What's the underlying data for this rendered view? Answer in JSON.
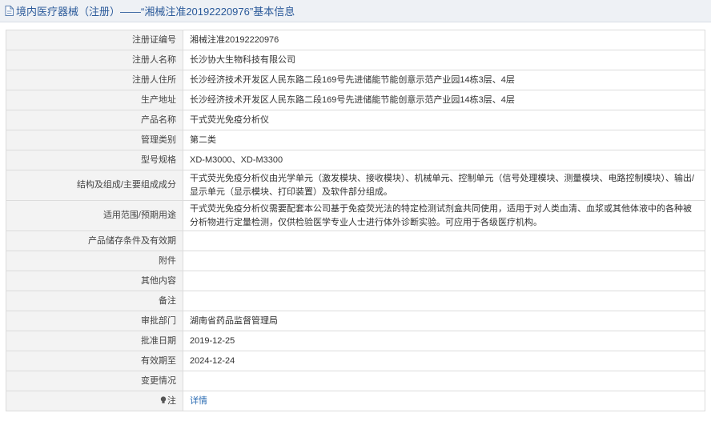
{
  "header": {
    "title": "境内医疗器械（注册）——“湘械注准20192220976”基本信息",
    "icon": "document-icon"
  },
  "rows": [
    {
      "label": "注册证编号",
      "value": "湘械注准20192220976"
    },
    {
      "label": "注册人名称",
      "value": "长沙协大生物科技有限公司"
    },
    {
      "label": "注册人住所",
      "value": "长沙经济技术开发区人民东路二段169号先进储能节能创意示范产业园14栋3层、4层"
    },
    {
      "label": "生产地址",
      "value": "长沙经济技术开发区人民东路二段169号先进储能节能创意示范产业园14栋3层、4层"
    },
    {
      "label": "产品名称",
      "value": "干式荧光免疫分析仪"
    },
    {
      "label": "管理类别",
      "value": "第二类"
    },
    {
      "label": "型号规格",
      "value": "XD-M3000、XD-M3300"
    },
    {
      "label": "结构及组成/主要组成成分",
      "value": "干式荧光免疫分析仪由光学单元（激发模块、接收模块）、机械单元、控制单元（信号处理模块、测量模块、电路控制模块）、输出/显示单元（显示模块、打印装置）及软件部分组成。"
    },
    {
      "label": "适用范围/预期用途",
      "value": "干式荧光免疫分析仪需要配套本公司基于免疫荧光法的特定检测试剂盒共同使用，适用于对人类血清、血浆或其他体液中的各种被分析物进行定量检测，仅供检验医学专业人士进行体外诊断实验。可应用于各级医疗机构。"
    },
    {
      "label": "产品储存条件及有效期",
      "value": ""
    },
    {
      "label": "附件",
      "value": ""
    },
    {
      "label": "其他内容",
      "value": ""
    },
    {
      "label": "备注",
      "value": ""
    },
    {
      "label": "审批部门",
      "value": "湖南省药品监督管理局"
    },
    {
      "label": "批准日期",
      "value": "2019-12-25"
    },
    {
      "label": "有效期至",
      "value": "2024-12-24"
    },
    {
      "label": "变更情况",
      "value": ""
    }
  ],
  "note": {
    "label": "注",
    "link_text": "详情",
    "icon": "lightbulb-icon"
  }
}
